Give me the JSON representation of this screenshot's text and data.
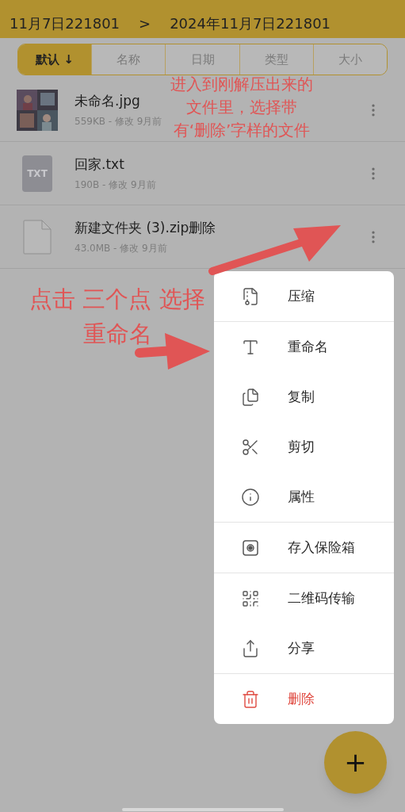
{
  "breadcrumb": {
    "items": [
      "11月7日221801",
      "2024年11月7日221801"
    ],
    "separator": ">"
  },
  "sort_tabs": [
    {
      "label": "默认 ↓",
      "selected": true
    },
    {
      "label": "名称",
      "selected": false
    },
    {
      "label": "日期",
      "selected": false
    },
    {
      "label": "类型",
      "selected": false
    },
    {
      "label": "大小",
      "selected": false
    }
  ],
  "files": [
    {
      "kind": "picture",
      "name": "未命名.jpg",
      "meta": "559KB - 修改 9月前"
    },
    {
      "kind": "txt",
      "badge": "TXT",
      "name": "回家.txt",
      "meta": "190B - 修改 9月前"
    },
    {
      "kind": "blank",
      "name": "新建文件夹 (3).zip删除",
      "meta": "43.0MB - 修改 9月前"
    }
  ],
  "annotations": [
    "进入到刚解压出来的文件里，选择带有‘删除’字样的文件",
    "点击 三个点 选择重命名"
  ],
  "context_menu": {
    "groups": [
      [
        {
          "label": "压缩",
          "danger": false
        }
      ],
      [
        {
          "label": "重命名",
          "danger": false
        },
        {
          "label": "复制",
          "danger": false
        },
        {
          "label": "剪切",
          "danger": false
        },
        {
          "label": "属性",
          "danger": false
        }
      ],
      [
        {
          "label": "存入保险箱",
          "danger": false
        }
      ],
      [
        {
          "label": "二维码传输",
          "danger": false
        },
        {
          "label": "分享",
          "danger": false
        }
      ],
      [
        {
          "label": "删除",
          "danger": true
        }
      ]
    ]
  },
  "fab": {
    "label": "+"
  }
}
